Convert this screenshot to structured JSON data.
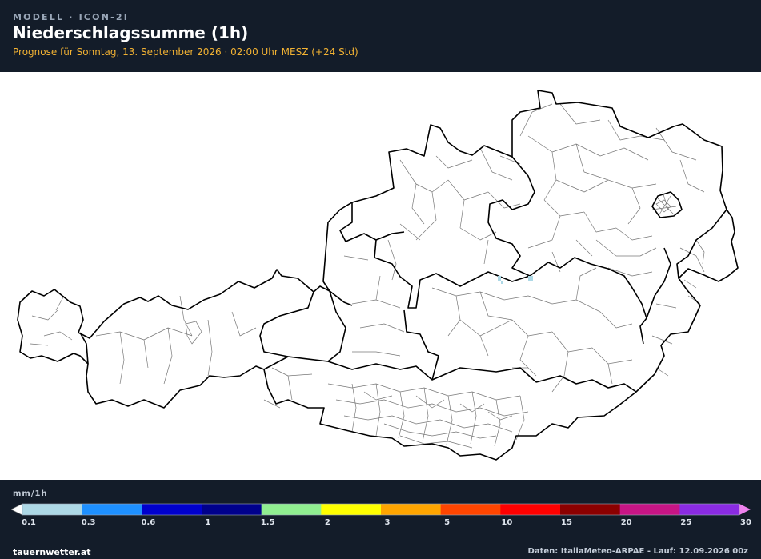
{
  "header": {
    "model": "MODELL · ICON-2I",
    "title": "Niederschlagssumme (1h)",
    "subtitle": "Prognose für Sonntag, 13. September 2026 · 02:00 Uhr MESZ  (+24 Std)"
  },
  "legend": {
    "unit": "mm/1h",
    "ticks": [
      "0.1",
      "0.3",
      "0.6",
      "1",
      "1.5",
      "2",
      "3",
      "5",
      "10",
      "15",
      "20",
      "25",
      "30"
    ],
    "colors": [
      "#add8e6",
      "#1e90ff",
      "#0000cd",
      "#00008b",
      "#90ee90",
      "#ffff00",
      "#ffa500",
      "#ff4500",
      "#ff0000",
      "#8b0000",
      "#c71585",
      "#8a2be2"
    ],
    "under_color": "#ffffff",
    "over_color": "#ee82ee"
  },
  "map": {
    "region": "Austria",
    "precip_color": "#add8e6"
  },
  "footer": {
    "site": "tauernwetter.at",
    "credits": "Daten: ItaliaMeteo-ARPAE - Lauf: 12.09.2026 00z"
  }
}
